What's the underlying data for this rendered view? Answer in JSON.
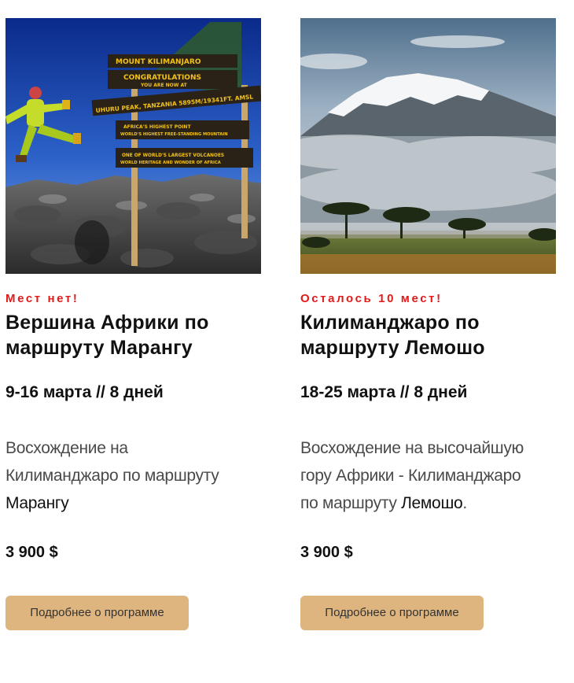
{
  "cards": [
    {
      "status": "Мест нет!",
      "title_line1": "Вершина Африки по",
      "title_line2": "маршруту Марангу",
      "dates": "9-16 марта // 8 дней",
      "desc_line1": "Восхождение на",
      "desc_line2": "Килиманджаро по маршруту",
      "desc_route": "Марангу",
      "desc_tail": "",
      "price": "3 900 $",
      "button": "Подробнее о программе",
      "photo": {
        "sign_1": "MOUNT KILIMANJARO",
        "sign_2": "CONGRATULATIONS",
        "sign_2b": "YOU ARE NOW AT",
        "sign_3": "UHURU PEAK, TANZANIA 5895M/19341FT. AMSL",
        "sign_4": "AFRICA'S HIGHEST POINT",
        "sign_4b": "WORLD'S HIGHEST FREE-STANDING MOUNTAIN",
        "sign_5": "ONE OF WORLD'S LARGEST VOLCANOES",
        "sign_5b": "WORLD HERITAGE AND WONDER OF AFRICA"
      }
    },
    {
      "status": "Осталось 10 мест!",
      "title_line1": "Килиманджаро по",
      "title_line2": "маршруту Лемошо",
      "dates": "18-25 марта // 8 дней",
      "desc_line1": "Восхождение на высочайшую",
      "desc_line2": "гору Африки - Килиманджаро",
      "desc_line3_pre": "по маршруту ",
      "desc_route": "Лемошо",
      "desc_tail": ".",
      "price": "3 900 $",
      "button": "Подробнее о программе"
    }
  ],
  "colors": {
    "status": "#e01b1b",
    "button_bg": "#dfb57f"
  }
}
